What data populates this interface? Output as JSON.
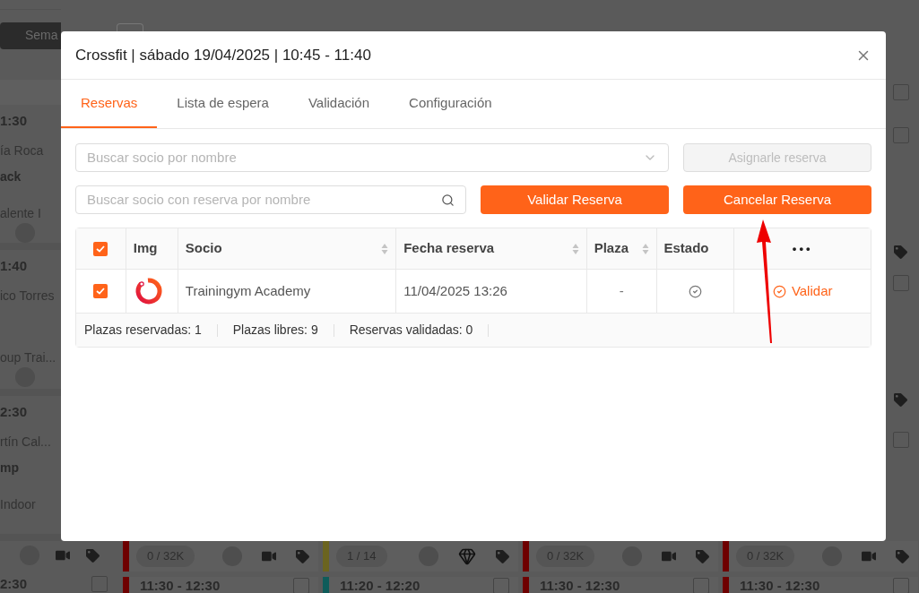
{
  "background": {
    "view_button": "Sema",
    "left_cards": [
      {
        "time": "1:30",
        "instructor": "ía Roca",
        "class": "ack",
        "room": "alente I"
      },
      {
        "time": "1:40",
        "instructor": "ico Torres",
        "room": "oup Trai..."
      },
      {
        "time": "2:30",
        "instructor": "rtín Cal...",
        "class": "mp",
        "room": "Indoor"
      }
    ],
    "bottom_cards": [
      {
        "count": "0 / 32K",
        "color": "#6e0000",
        "kind": "video",
        "next": {
          "time": "11:30 - 12:30",
          "color": "#6e0000",
          "checked": false
        }
      },
      {
        "count": "1 / 14",
        "color": "#6b6420",
        "kind": "premium",
        "next": {
          "time": "11:20 - 12:20",
          "color": "#0f5c5a",
          "checked": false
        }
      },
      {
        "count": "0 / 32K",
        "color": "#6e0000",
        "kind": "video",
        "next": {
          "time": "11:30 - 12:30",
          "color": "#6e0000",
          "checked": false
        }
      },
      {
        "count": "0 / 32K",
        "color": "#6e0000",
        "kind": "video",
        "next": {
          "time": "11:30 - 12:30",
          "color": "#6e0000",
          "checked": false
        }
      }
    ],
    "first_next": {
      "time": "2:30",
      "checked": false
    },
    "right_column": [
      {
        "kind": "checkbox",
        "checked": false
      },
      {
        "kind": "checkbox",
        "checked": false
      },
      {
        "kind": "tag"
      },
      {
        "kind": "checkbox",
        "checked": false
      },
      {
        "kind": "tag"
      },
      {
        "kind": "checkbox",
        "checked": false
      }
    ]
  },
  "modal": {
    "title": "Crossfit | sábado 19/04/2025 | 10:45 - 11:40",
    "tabs": [
      {
        "label": "Reservas",
        "selected": true
      },
      {
        "label": "Lista de espera",
        "selected": false
      },
      {
        "label": "Validación",
        "selected": false
      },
      {
        "label": "Configuración",
        "selected": false
      }
    ],
    "member_select": {
      "placeholder": "Buscar socio por nombre"
    },
    "assign_button": {
      "label": "Asignarle reserva",
      "disabled": true
    },
    "search": {
      "placeholder": "Buscar socio con reserva por nombre"
    },
    "actions": [
      {
        "label": "Validar Reserva"
      },
      {
        "label": "Cancelar Reserva"
      }
    ],
    "table": {
      "all_checked": true,
      "columns": [
        {
          "label": "Img",
          "sortable": false
        },
        {
          "label": "Socio",
          "sortable": true
        },
        {
          "label": "Fecha reserva",
          "sortable": true
        },
        {
          "label": "Plaza",
          "sortable": true
        },
        {
          "label": "Estado",
          "sortable": false
        },
        {
          "label": "•••",
          "sortable": false
        }
      ],
      "rows": [
        {
          "checked": true,
          "member": "Trainingym Academy",
          "date": "11/04/2025 13:26",
          "place": "-",
          "action": "Validar"
        }
      ],
      "summary": [
        "Plazas reservadas: 1",
        "Plazas libres: 9",
        "Reservas validadas: 0"
      ]
    }
  }
}
